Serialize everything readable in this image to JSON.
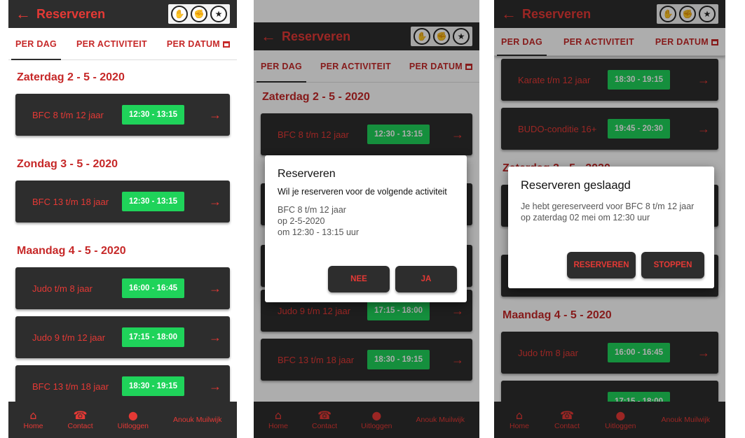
{
  "app": {
    "title": "Reserveren",
    "back_icon": "←",
    "logos": [
      "hand-logo",
      "fist-logo",
      "muilwijk-logo"
    ]
  },
  "tabs": {
    "per_dag": "PER DAG",
    "per_activiteit": "PER ACTIVITEIT",
    "per_datum": "PER DATUM"
  },
  "screen1": {
    "groups": [
      {
        "date": "Zaterdag 2 - 5 - 2020",
        "items": [
          {
            "name": "BFC 8 t/m 12 jaar",
            "time": "12:30 - 13:15"
          }
        ]
      },
      {
        "date": "Zondag 3 - 5 - 2020",
        "items": [
          {
            "name": "BFC 13 t/m 18 jaar",
            "time": "12:30 - 13:15"
          }
        ]
      },
      {
        "date": "Maandag 4 - 5 - 2020",
        "items": [
          {
            "name": "Judo t/m 8 jaar",
            "time": "16:00 - 16:45"
          },
          {
            "name": "Judo 9 t/m 12 jaar",
            "time": "17:15 - 18:00"
          },
          {
            "name": "BFC 13 t/m 18 jaar",
            "time": "18:30 - 19:15"
          }
        ]
      }
    ]
  },
  "screen2": {
    "date": "Zaterdag 2 - 5 - 2020",
    "items": [
      {
        "name": "BFC 8 t/m 12 jaar",
        "time": "12:30 - 13:15"
      },
      {
        "name": "",
        "time": ""
      },
      {
        "name": "",
        "time": ""
      },
      {
        "name": "",
        "time": ""
      },
      {
        "name": "Judo 9 t/m 12 jaar",
        "time": "17:15 - 18:00"
      },
      {
        "name": "BFC 13 t/m 18 jaar",
        "time": "18:30 - 19:15"
      }
    ],
    "dialog": {
      "title": "Reserveren",
      "subtitle": "Wil je reserveren voor de volgende activiteit",
      "line1": "BFC 8 t/m 12 jaar",
      "line2": "op 2-5-2020",
      "line3": "om 12:30 - 13:15 uur",
      "no": "NEE",
      "yes": "JA"
    }
  },
  "screen3": {
    "items_top": [
      {
        "name": "Karate t/m 12 jaar",
        "time": "18:30 - 19:15"
      },
      {
        "name": "BUDO-conditie 16+",
        "time": "19:45 - 20:30"
      }
    ],
    "date1": "Zaterdag 2 - 5 - 2020",
    "date2": "Maandag 4 - 5 - 2020",
    "items_bottom": [
      {
        "name": "Judo t/m 8 jaar",
        "time": "16:00 - 16:45"
      },
      {
        "name": "",
        "time": "17:15 - 18:00"
      }
    ],
    "dialog": {
      "title": "Reserveren geslaagd",
      "line1": "Je hebt gereserveerd voor BFC 8 t/m 12 jaar",
      "line2": "op zaterdag 02 mei om 12:30 uur",
      "btn1": "RESERVEREN",
      "btn2": "STOPPEN"
    }
  },
  "bottom_nav": {
    "home": "Home",
    "contact": "Contact",
    "logout": "Uitloggen",
    "user": "Anouk Muilwijk"
  },
  "colors": {
    "accent": "#e53935",
    "dark": "#2d2d2d",
    "time_green": "#1fd35a"
  }
}
